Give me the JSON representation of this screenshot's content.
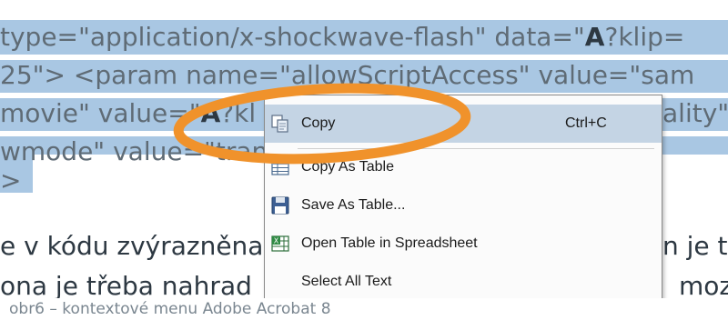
{
  "code": {
    "line1_a": "type=\"application/x-shockwave-flash\" data=\"",
    "line1_b": "A",
    "line1_c": "?klip=",
    "line2": "25\"> <param name=\"allowScriptAccess\" value=\"sam",
    "line3_a": "movie\" value=\"",
    "line3_b": "A",
    "line3_c": "?kl",
    "line3_right": "ality\"",
    "line4": "wmode\" value=\"trans",
    "line5": ">"
  },
  "paragraph": {
    "line1_left": "e v kódu zvýrazněna",
    "line1_right": "n je t",
    "line2_left": "ona je třeba nahrad",
    "line2_right": "moz"
  },
  "menu": {
    "items": [
      {
        "label": "Copy",
        "shortcut": "Ctrl+C",
        "icon": "copy-icon"
      },
      {
        "label": "Copy As Table",
        "shortcut": "",
        "icon": "table-icon"
      },
      {
        "label": "Save As Table...",
        "shortcut": "",
        "icon": "floppy-disk-icon"
      },
      {
        "label": "Open Table in Spreadsheet",
        "shortcut": "",
        "icon": "spreadsheet-icon"
      },
      {
        "label": "Select All Text",
        "shortcut": "",
        "icon": ""
      }
    ]
  },
  "caption": "obr6 – kontextové menu Adobe Acrobat 8",
  "colors": {
    "selection": "#a9c7e3",
    "highlight_ring": "#f0922b",
    "menu_hover": "#c4d4e4"
  }
}
